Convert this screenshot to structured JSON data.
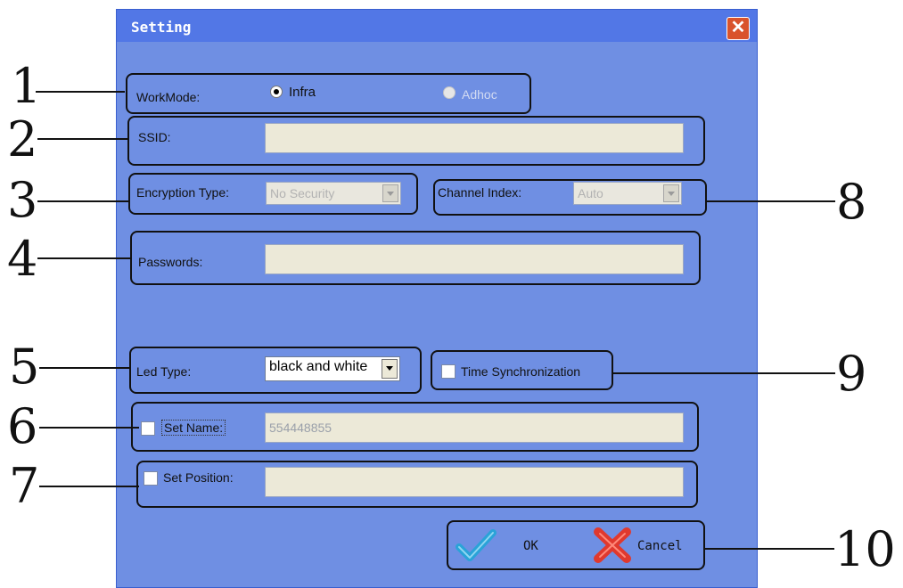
{
  "dialog": {
    "title": "Setting",
    "close_glyph": "✕"
  },
  "workmode": {
    "label": "WorkMode:",
    "options": [
      {
        "label": "Infra",
        "selected": true
      },
      {
        "label": "Adhoc",
        "selected": false,
        "disabled": true
      }
    ]
  },
  "ssid": {
    "label": "SSID:",
    "value": ""
  },
  "encryption": {
    "label": "Encryption Type:",
    "value": "No Security"
  },
  "channel": {
    "label": "Channel Index:",
    "value": "Auto"
  },
  "passwords": {
    "label": "Passwords:",
    "value": ""
  },
  "led_type": {
    "label": "Led Type:",
    "value": "black and white"
  },
  "time_sync": {
    "label": "Time Synchronization",
    "checked": false
  },
  "set_name": {
    "label": "Set Name:",
    "value": "554448855",
    "checked": false
  },
  "set_position": {
    "label": "Set Position:",
    "value": "",
    "checked": false
  },
  "buttons": {
    "ok": "OK",
    "cancel": "Cancel"
  },
  "callouts": [
    "1",
    "2",
    "3",
    "4",
    "5",
    "6",
    "7",
    "8",
    "9",
    "10"
  ],
  "colors": {
    "dialog_bg": "#6f8fe3",
    "titlebar": "#5277e6",
    "close_button": "#d9532c",
    "ok_check": "#2aa3d8",
    "cancel_x": "#e0392e"
  },
  "icons": {
    "ok": "check-icon",
    "cancel": "cancel-x-icon",
    "close": "close-icon"
  }
}
